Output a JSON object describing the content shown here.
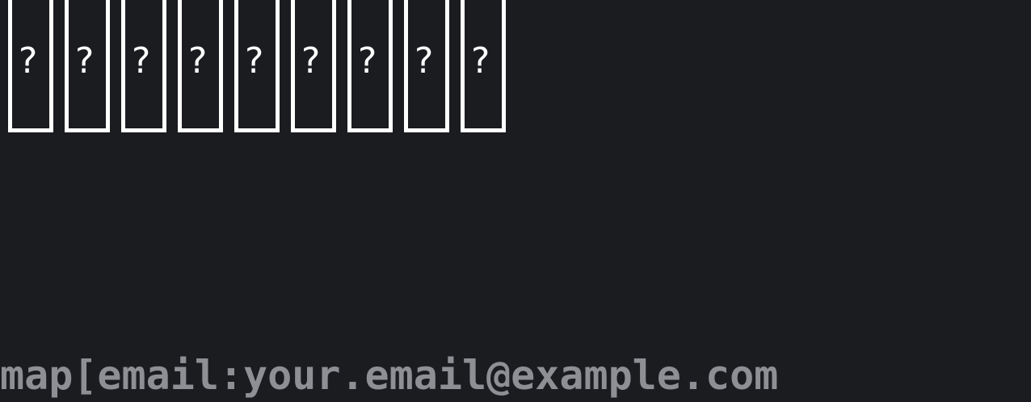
{
  "placeholder_glyphs": [
    "?",
    "?",
    "?",
    "?",
    "?",
    "?",
    "?",
    "?",
    "?"
  ],
  "bottom_line": "map[email:your.email@example.com"
}
